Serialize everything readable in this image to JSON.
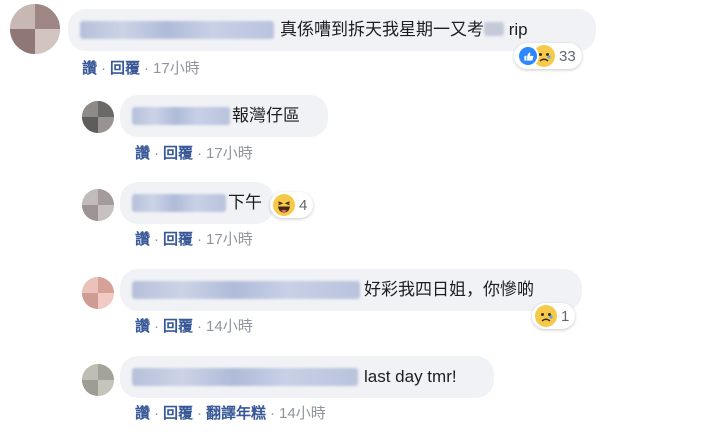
{
  "comments": [
    {
      "text_before": "真係嘈到拆天我星期一又考",
      "text_after": " rip",
      "actions": {
        "like": "讚",
        "reply": "回覆",
        "time": "17小時"
      },
      "reactions": {
        "icons": [
          "like-icon",
          "sad-icon"
        ],
        "count": "33"
      }
    },
    {
      "text": "報灣仔區",
      "actions": {
        "like": "讚",
        "reply": "回覆",
        "time": "17小時"
      }
    },
    {
      "text": "下午",
      "actions": {
        "like": "讚",
        "reply": "回覆",
        "time": "17小時"
      },
      "reactions": {
        "icons": [
          "haha-icon"
        ],
        "count": "4"
      }
    },
    {
      "text": "好彩我四日姐，你慘啲",
      "actions": {
        "like": "讚",
        "reply": "回覆",
        "time": "14小時"
      },
      "reactions": {
        "icons": [
          "sad-icon"
        ],
        "count": "1"
      }
    },
    {
      "text": "last day tmr!",
      "actions": {
        "like": "讚",
        "reply": "回覆",
        "translate": "翻譯年糕",
        "time": "14小時"
      }
    }
  ],
  "colors": {
    "link": "#385898",
    "bubble": "#f1f2f6",
    "meta": "#90949c",
    "like_blue": "#2d88ff",
    "emoji_yellow": "#f7c94a"
  }
}
